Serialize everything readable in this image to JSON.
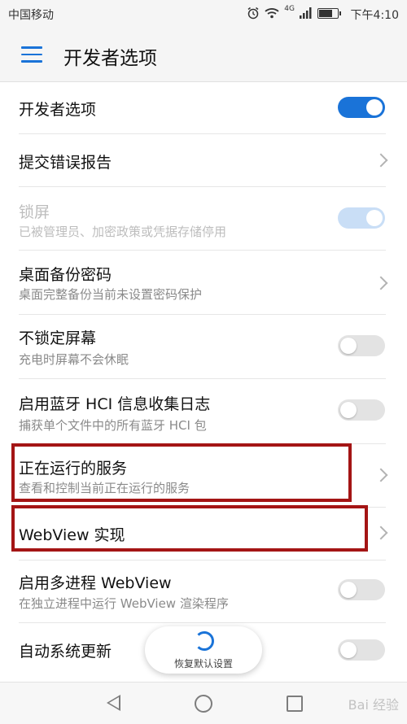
{
  "status_bar": {
    "carrier": "中国移动",
    "time": "下午4:10",
    "icons": [
      "alarm-icon",
      "wifi-icon",
      "signal-icon",
      "battery-icon"
    ],
    "network": "4G"
  },
  "app_bar": {
    "title": "开发者选项",
    "menu_icon": "menu-icon"
  },
  "items": [
    {
      "label": "开发者选项",
      "control": "toggle",
      "state": "on"
    },
    {
      "label": "提交错误报告",
      "control": "chevron"
    },
    {
      "label": "锁屏",
      "sublabel": "已被管理员、加密政策或凭据存储停用",
      "control": "toggle",
      "state": "on",
      "disabled": true
    },
    {
      "label": "桌面备份密码",
      "sublabel": "桌面完整备份当前未设置密码保护",
      "control": "chevron"
    },
    {
      "label": "不锁定屏幕",
      "sublabel": "充电时屏幕不会休眠",
      "control": "toggle",
      "state": "off"
    },
    {
      "label": "启用蓝牙 HCI 信息收集日志",
      "sublabel": "捕获单个文件中的所有蓝牙 HCI 包",
      "control": "toggle",
      "state": "off"
    },
    {
      "label": "正在运行的服务",
      "sublabel": "查看和控制当前正在运行的服务",
      "control": "chevron",
      "highlighted": true
    },
    {
      "label": "WebView 实现",
      "control": "chevron",
      "highlighted": true
    },
    {
      "label": "启用多进程 WebView",
      "sublabel": "在独立进程中运行 WebView 渲染程序",
      "control": "toggle",
      "state": "off"
    },
    {
      "label": "自动系统更新",
      "control": "toggle",
      "state": "off"
    }
  ],
  "restore_button": {
    "label": "恢复默认设置",
    "icon": "refresh-icon"
  },
  "nav_bar": {
    "icons": [
      "back-icon",
      "home-icon",
      "recents-icon"
    ]
  },
  "watermark": "Bai 经验",
  "colors": {
    "accent": "#1a73d8",
    "highlight_border": "#a41515",
    "toggle_off": "#e3e3e3"
  }
}
